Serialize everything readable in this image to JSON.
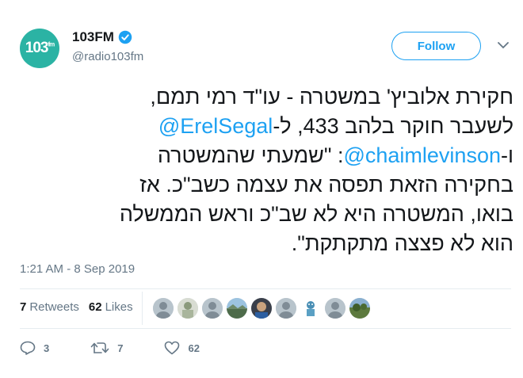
{
  "account": {
    "display_name": "103FM",
    "handle": "@radio103fm",
    "avatar_text": "103",
    "avatar_sup": "fm",
    "verified": true
  },
  "follow_label": "Follow",
  "tweet": {
    "line1": "חקירת אלוביץ' במשטרה - עו\"ד רמי תמם,",
    "line2_text": "לשעבר חוקר בלהב 433, ל-",
    "line2_mention": "@ErelSegal",
    "line3_prefix": "ו-",
    "line3_mention": "@chaimlevinson",
    "line3_text": ": \"שמעתי שהמשטרה",
    "line4": "בחקירה הזאת תפסה את עצמה כשב\"כ. אז",
    "line5": "בואו, המשטרה היא לא שב\"כ וראש הממשלה",
    "line6": "הוא לא פצצה מתקתקת\"."
  },
  "timestamp": "1:21 AM - 8 Sep 2019",
  "stats": {
    "retweets_count": "7",
    "retweets_label": "Retweets",
    "likes_count": "62",
    "likes_label": "Likes"
  },
  "actions": {
    "replies": "3",
    "retweets": "7",
    "likes": "62"
  },
  "colors": {
    "accent": "#1da1f2",
    "muted": "#657786",
    "avatar_bg": "#2bb3a4"
  },
  "likers": [
    "default-avatar",
    "photo-avatar",
    "default-avatar",
    "landscape-avatar",
    "person-avatar",
    "default-avatar",
    "cartoon-avatar",
    "default-avatar",
    "landscape-avatar"
  ]
}
